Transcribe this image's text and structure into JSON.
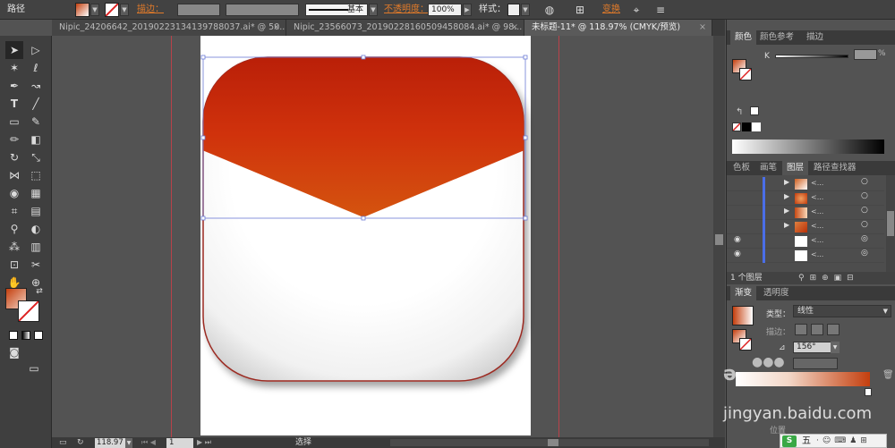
{
  "control_bar": {
    "object_type": "路径",
    "stroke_label": "描边：",
    "stroke_style": "基本",
    "opacity_label": "不透明度：",
    "opacity_value": "100%",
    "style_label": "样式：",
    "transform_label": "变换"
  },
  "tabs": [
    {
      "label": "Nipic_24206642_20190223134139788037.ai* @ 50..."
    },
    {
      "label": "Nipic_23566073_20190228160509458084.ai* @ 98..."
    },
    {
      "label": "未标题-11* @ 118.97% (CMYK/预览)"
    }
  ],
  "color_panel": {
    "tabs": [
      "颜色",
      "颜色参考",
      "描边"
    ],
    "channel_label": "K",
    "channel_value": "",
    "colors": {
      "fill_gradient_start": "#c43f0e",
      "fill_gradient_end": "#ffffff"
    }
  },
  "layers_panel": {
    "tabs": [
      "色板",
      "画笔",
      "图层",
      "路径查找器"
    ],
    "rows": [
      {
        "name": "<..."
      },
      {
        "name": "<..."
      },
      {
        "name": "<..."
      },
      {
        "name": "<..."
      },
      {
        "name": "<..."
      },
      {
        "name": "<..."
      },
      {
        "name": "<..."
      }
    ],
    "footer": "1 个图层"
  },
  "gradient_panel": {
    "tabs": [
      "渐变",
      "透明度"
    ],
    "type_label": "类型：",
    "type_value": "线性",
    "stroke_label": "描边：",
    "angle_value": "156°",
    "position_label": "位置"
  },
  "status_bar": {
    "zoom": "118.97",
    "page": "1",
    "selection": "选择"
  },
  "watermark": "jingyan.baidu.com",
  "ime": "五"
}
